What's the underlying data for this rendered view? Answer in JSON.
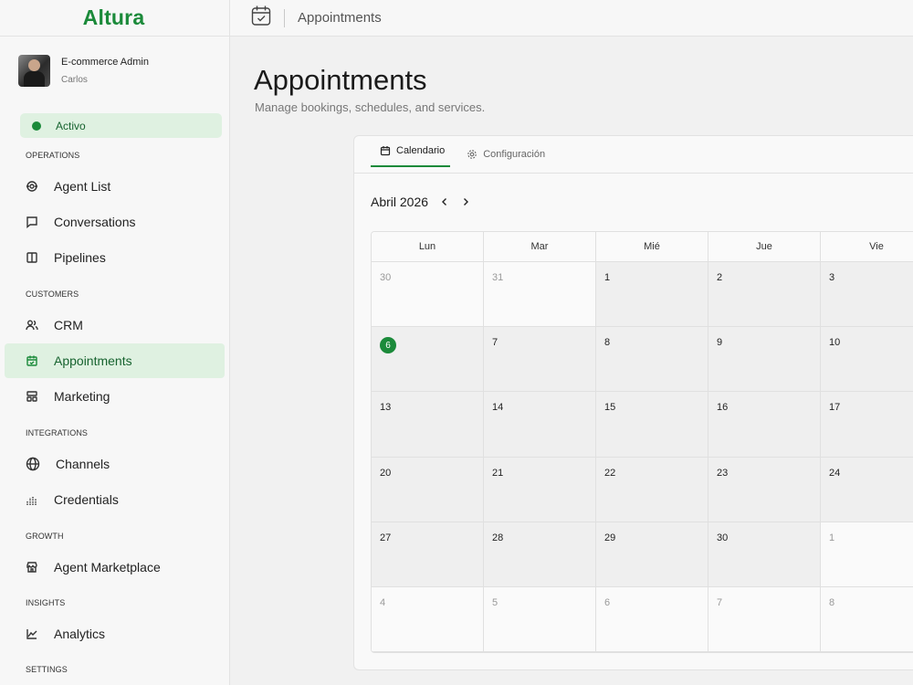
{
  "app": {
    "brand": "Altura"
  },
  "profile": {
    "name": "E-commerce Admin",
    "sub": "Carlos"
  },
  "status": {
    "label": "Activo",
    "color": "#1b8a3a"
  },
  "sidebar": {
    "sections": [
      "OPERATIONS",
      "CUSTOMERS",
      "INTEGRATIONS",
      "GROWTH",
      "INSIGHTS",
      "SETTINGS"
    ],
    "items": [
      {
        "label": "Agent List",
        "icon": "agent-icon"
      },
      {
        "label": "Conversations",
        "icon": "chat-icon"
      },
      {
        "label": "Pipelines",
        "icon": "columns-icon"
      },
      {
        "label": "CRM",
        "icon": "users-icon"
      },
      {
        "label": "Appointments",
        "icon": "calendar-icon",
        "active": true
      },
      {
        "label": "Marketing",
        "icon": "layout-icon"
      },
      {
        "label": "Channels",
        "icon": "globe-icon"
      },
      {
        "label": "Credentials",
        "icon": "bars-icon"
      },
      {
        "label": "Agent Marketplace",
        "icon": "store-icon"
      },
      {
        "label": "Analytics",
        "icon": "chart-icon"
      }
    ]
  },
  "header": {
    "breadcrumb": "Appointments"
  },
  "page": {
    "title": "Appointments",
    "subtitle": "Manage bookings, schedules, and services."
  },
  "tabs": [
    {
      "label": "Calendario",
      "active": true
    },
    {
      "label": "Configuración",
      "active": false
    }
  ],
  "calendar": {
    "month": "Abril 2026",
    "prev": "‹",
    "next": "›",
    "weekdays": [
      "Lun",
      "Mar",
      "Mié",
      "Jue",
      "Vie"
    ],
    "weeks": [
      [
        {
          "d": "30",
          "m": "other"
        },
        {
          "d": "31",
          "m": "other"
        },
        {
          "d": "1",
          "m": "cur"
        },
        {
          "d": "2",
          "m": "cur"
        },
        {
          "d": "3",
          "m": "cur"
        }
      ],
      [
        {
          "d": "6",
          "m": "today"
        },
        {
          "d": "7",
          "m": "cur"
        },
        {
          "d": "8",
          "m": "cur"
        },
        {
          "d": "9",
          "m": "cur"
        },
        {
          "d": "10",
          "m": "cur"
        }
      ],
      [
        {
          "d": "13",
          "m": "cur"
        },
        {
          "d": "14",
          "m": "cur"
        },
        {
          "d": "15",
          "m": "cur"
        },
        {
          "d": "16",
          "m": "cur"
        },
        {
          "d": "17",
          "m": "cur"
        }
      ],
      [
        {
          "d": "20",
          "m": "cur"
        },
        {
          "d": "21",
          "m": "cur"
        },
        {
          "d": "22",
          "m": "cur"
        },
        {
          "d": "23",
          "m": "cur"
        },
        {
          "d": "24",
          "m": "cur"
        }
      ],
      [
        {
          "d": "27",
          "m": "cur"
        },
        {
          "d": "28",
          "m": "cur"
        },
        {
          "d": "29",
          "m": "cur"
        },
        {
          "d": "30",
          "m": "cur"
        },
        {
          "d": "1",
          "m": "other"
        }
      ],
      [
        {
          "d": "4",
          "m": "other"
        },
        {
          "d": "5",
          "m": "other"
        },
        {
          "d": "6",
          "m": "other"
        },
        {
          "d": "7",
          "m": "other"
        },
        {
          "d": "8",
          "m": "other"
        }
      ]
    ]
  }
}
